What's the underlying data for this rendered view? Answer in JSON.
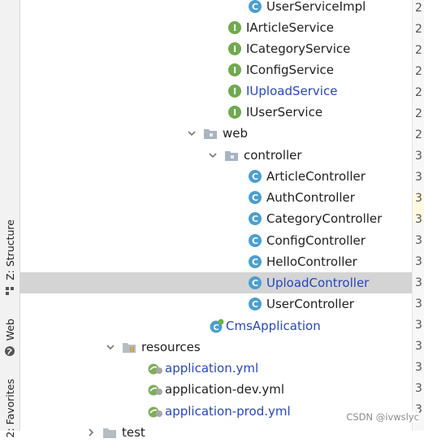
{
  "sidebar": {
    "structure_label": "Z: Structure",
    "web_label": "Web",
    "favorites_label": "2: Favorites"
  },
  "tree": [
    {
      "label": "UserServiceImpl",
      "icon": "class-icon",
      "color": "normal"
    },
    {
      "label": "IArticleService",
      "icon": "interface-icon",
      "color": "normal"
    },
    {
      "label": "ICategoryService",
      "icon": "interface-icon",
      "color": "normal"
    },
    {
      "label": "IConfigService",
      "icon": "interface-icon",
      "color": "normal"
    },
    {
      "label": "IUploadService",
      "icon": "interface-icon",
      "color": "blue"
    },
    {
      "label": "IUserService",
      "icon": "interface-icon",
      "color": "normal"
    },
    {
      "label": "web",
      "icon": "package-folder-icon",
      "expanded": true
    },
    {
      "label": "controller",
      "icon": "package-folder-icon",
      "expanded": true
    },
    {
      "label": "ArticleController",
      "icon": "class-icon",
      "color": "normal"
    },
    {
      "label": "AuthController",
      "icon": "class-icon",
      "color": "normal"
    },
    {
      "label": "CategoryController",
      "icon": "class-icon",
      "color": "normal"
    },
    {
      "label": "ConfigController",
      "icon": "class-icon",
      "color": "normal"
    },
    {
      "label": "HelloController",
      "icon": "class-icon",
      "color": "normal"
    },
    {
      "label": "UploadController",
      "icon": "class-icon",
      "color": "blue",
      "selected": true
    },
    {
      "label": "UserController",
      "icon": "class-icon",
      "color": "normal"
    },
    {
      "label": "CmsApplication",
      "icon": "spring-boot-class-icon",
      "color": "blue"
    },
    {
      "label": "resources",
      "icon": "resources-folder-icon",
      "expanded": true
    },
    {
      "label": "application.yml",
      "icon": "spring-yml-icon",
      "color": "blue"
    },
    {
      "label": "application-dev.yml",
      "icon": "spring-yml-icon",
      "color": "normal"
    },
    {
      "label": "application-prod.yml",
      "icon": "spring-yml-icon",
      "color": "blue"
    },
    {
      "label": "test",
      "icon": "folder-icon",
      "collapsed": true
    }
  ],
  "gutter_numbers": [
    "2",
    "2",
    "2",
    "2",
    "2",
    "2",
    "2",
    "3",
    "3",
    "3",
    "3",
    "3",
    "3",
    "3",
    "3",
    "3",
    "3",
    "3",
    "3",
    "3"
  ],
  "watermark": "CSDN @ivwslyc",
  "colors": {
    "selected_bg": "#d4d4d4",
    "modified_text": "#2747b9",
    "class_icon": "#4a9fd0",
    "interface_icon": "#6faa4e"
  }
}
